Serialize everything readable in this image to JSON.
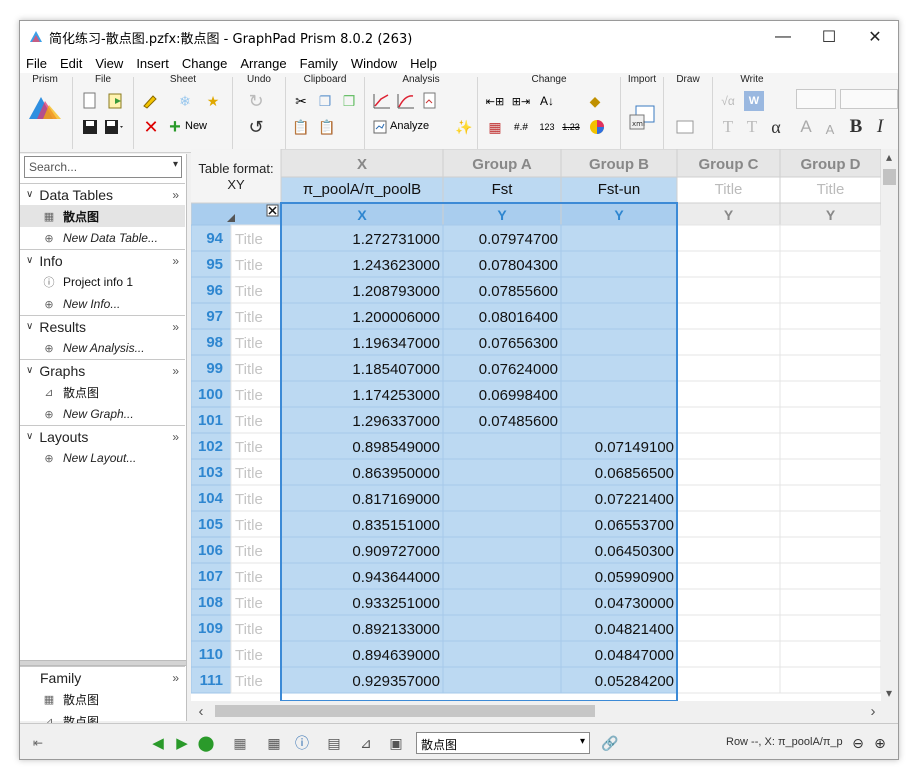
{
  "window": {
    "title": "简化练习-散点图.pzfx:散点图 - GraphPad Prism 8.0.2 (263)",
    "minimize": "—",
    "maximize": "☐",
    "close": "✕"
  },
  "menu": [
    "File",
    "Edit",
    "View",
    "Insert",
    "Change",
    "Arrange",
    "Family",
    "Window",
    "Help"
  ],
  "ribbon": {
    "groups": [
      "Prism",
      "File",
      "Sheet",
      "Undo",
      "Clipboard",
      "Analysis",
      "Change",
      "Import",
      "Draw",
      "Write"
    ],
    "new_label": "New",
    "analyze_label": "Analyze",
    "write_glyphs": [
      "√α",
      "W",
      "A",
      "A",
      "B",
      "I",
      "α",
      "T",
      "T"
    ]
  },
  "nav": {
    "search_placeholder": "Search...",
    "sections": [
      {
        "title": "Data Tables",
        "items": [
          {
            "label": "散点图",
            "icon": "table-icon",
            "selected": true
          },
          {
            "label": "New Data Table...",
            "icon": "plus-icon",
            "new": true
          }
        ]
      },
      {
        "title": "Info",
        "items": [
          {
            "label": "Project info 1",
            "icon": "info-icon"
          },
          {
            "label": "New Info...",
            "icon": "plus-icon",
            "new": true
          }
        ]
      },
      {
        "title": "Results",
        "items": [
          {
            "label": "New Analysis...",
            "icon": "plus-icon",
            "new": true
          }
        ]
      },
      {
        "title": "Graphs",
        "items": [
          {
            "label": "散点图",
            "icon": "graph-icon"
          },
          {
            "label": "New Graph...",
            "icon": "plus-icon",
            "new": true
          }
        ]
      },
      {
        "title": "Layouts",
        "items": [
          {
            "label": "New Layout...",
            "icon": "plus-icon",
            "new": true
          }
        ]
      }
    ],
    "family": {
      "title": "Family",
      "items": [
        {
          "label": "散点图",
          "icon": "table-icon"
        },
        {
          "label": "散点图",
          "icon": "graph-icon"
        }
      ]
    }
  },
  "sheet": {
    "table_format_label": "Table format:",
    "table_format_value": "XY",
    "columns": [
      {
        "group": "X",
        "title": "π_poolA/π_poolB",
        "sub": "X",
        "selected": true
      },
      {
        "group": "Group A",
        "title": "Fst",
        "sub": "Y",
        "selected": true
      },
      {
        "group": "Group B",
        "title": "Fst-un",
        "sub": "Y",
        "selected": true
      },
      {
        "group": "Group C",
        "title": "Title",
        "sub": "Y",
        "selected": false,
        "placeholder": true
      },
      {
        "group": "Group D",
        "title": "Title",
        "sub": "Y",
        "selected": false,
        "placeholder": true
      }
    ],
    "row_title_placeholder": "Title",
    "rows": [
      {
        "n": "94",
        "x": "1.272731000",
        "a": "0.07974700",
        "b": ""
      },
      {
        "n": "95",
        "x": "1.243623000",
        "a": "0.07804300",
        "b": ""
      },
      {
        "n": "96",
        "x": "1.208793000",
        "a": "0.07855600",
        "b": ""
      },
      {
        "n": "97",
        "x": "1.200006000",
        "a": "0.08016400",
        "b": ""
      },
      {
        "n": "98",
        "x": "1.196347000",
        "a": "0.07656300",
        "b": ""
      },
      {
        "n": "99",
        "x": "1.185407000",
        "a": "0.07624000",
        "b": ""
      },
      {
        "n": "100",
        "x": "1.174253000",
        "a": "0.06998400",
        "b": ""
      },
      {
        "n": "101",
        "x": "1.296337000",
        "a": "0.07485600",
        "b": ""
      },
      {
        "n": "102",
        "x": "0.898549000",
        "a": "",
        "b": "0.07149100"
      },
      {
        "n": "103",
        "x": "0.863950000",
        "a": "",
        "b": "0.06856500"
      },
      {
        "n": "104",
        "x": "0.817169000",
        "a": "",
        "b": "0.07221400"
      },
      {
        "n": "105",
        "x": "0.835151000",
        "a": "",
        "b": "0.06553700"
      },
      {
        "n": "106",
        "x": "0.909727000",
        "a": "",
        "b": "0.06450300"
      },
      {
        "n": "107",
        "x": "0.943644000",
        "a": "",
        "b": "0.05990900"
      },
      {
        "n": "108",
        "x": "0.933251000",
        "a": "",
        "b": "0.04730000"
      },
      {
        "n": "109",
        "x": "0.892133000",
        "a": "",
        "b": "0.04821400"
      },
      {
        "n": "110",
        "x": "0.894639000",
        "a": "",
        "b": "0.04847000"
      },
      {
        "n": "111",
        "x": "0.929357000",
        "a": "",
        "b": "0.05284200"
      }
    ]
  },
  "status": {
    "sheet_select": "散点图",
    "readout": "Row --, X: π_poolA/π_p"
  },
  "colors": {
    "selection": "#bcd9f2",
    "header_blue": "#2e86d0",
    "selection_border": "#3c8ad6"
  }
}
